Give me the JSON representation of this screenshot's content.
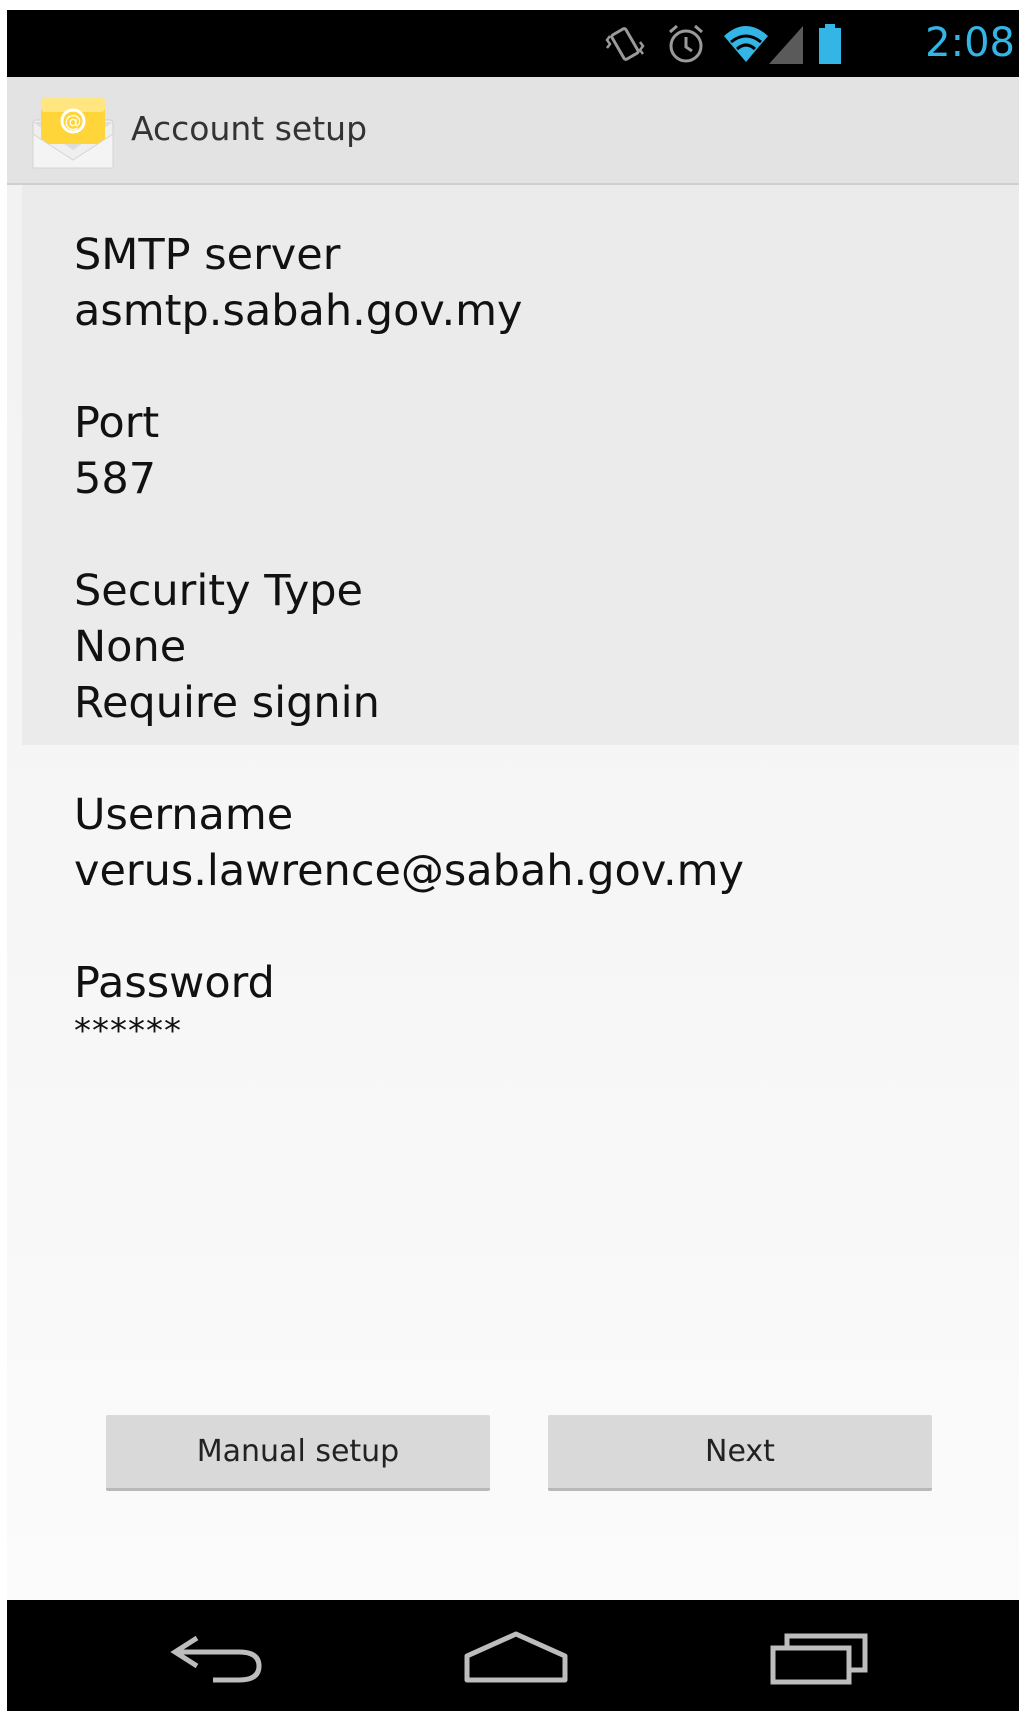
{
  "status_bar": {
    "time": "2:08",
    "icons": [
      "vibrate-icon",
      "alarm-icon",
      "wifi-icon",
      "signal-icon",
      "battery-icon"
    ],
    "accent_color": "#33b5e5"
  },
  "action_bar": {
    "title": "Account setup",
    "icon": "email-envelope-icon"
  },
  "fields": {
    "smtp_server": {
      "label": "SMTP server",
      "value": "asmtp.sabah.gov.my"
    },
    "port": {
      "label": "Port",
      "value": "587"
    },
    "security_type": {
      "label": "Security Type",
      "value": "None",
      "extra": "Require signin"
    },
    "username": {
      "label": "Username",
      "value": "verus.lawrence@sabah.gov.my"
    },
    "password": {
      "label": "Password",
      "value": "******"
    }
  },
  "buttons": {
    "manual_setup": "Manual setup",
    "next": "Next"
  },
  "nav_bar": {
    "icons": [
      "back-icon",
      "home-icon",
      "recent-apps-icon"
    ]
  }
}
